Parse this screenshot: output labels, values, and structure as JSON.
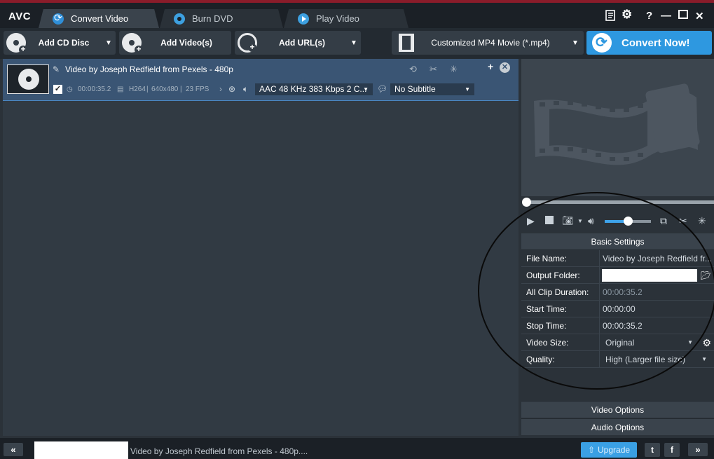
{
  "app": {
    "logo": "AVC"
  },
  "tabs": [
    {
      "label": "Convert Video",
      "icon": "convert-icon"
    },
    {
      "label": "Burn DVD",
      "icon": "dvd-icon"
    },
    {
      "label": "Play Video",
      "icon": "play-icon"
    }
  ],
  "window_controls": {
    "help": "?",
    "minimize": "—",
    "close": "✕"
  },
  "toolbar": {
    "add_cd": "Add CD Disc",
    "add_videos": "Add Video(s)",
    "add_urls": "Add URL(s)",
    "profile": "Customized MP4 Movie (*.mp4)",
    "convert": "Convert Now!"
  },
  "file": {
    "title": "Video by Joseph Redfield from Pexels - 480p",
    "duration": "00:00:35.2",
    "codec": "H264",
    "resolution": "640x480",
    "fps": "23 FPS",
    "audio": "AAC 48 KHz 383 Kbps 2 C...",
    "subtitle": "No Subtitle",
    "checked": "✓"
  },
  "settings": {
    "header": "Basic Settings",
    "rows": [
      {
        "label": "File Name:",
        "value": "Video by Joseph Redfield fr..."
      },
      {
        "label": "Output Folder:",
        "value": ""
      },
      {
        "label": "All Clip Duration:",
        "value": "00:00:35.2"
      },
      {
        "label": "Start Time:",
        "value": "00:00:00"
      },
      {
        "label": "Stop Time:",
        "value": "00:00:35.2"
      },
      {
        "label": "Video Size:",
        "value": "Original"
      },
      {
        "label": "Quality:",
        "value": "High (Larger file size)"
      }
    ],
    "video_options": "Video Options",
    "audio_options": "Audio Options"
  },
  "player": {
    "volume_fraction": 0.5,
    "seek_fraction": 0.0
  },
  "status": {
    "text": "Video by Joseph Redfield from Pexels - 480p....",
    "upgrade": "Upgrade",
    "twitter": "t",
    "facebook": "f"
  },
  "colors": {
    "accent": "#2e98e0",
    "selected_row": "#3a5574",
    "titlebar": "#1b2026"
  }
}
